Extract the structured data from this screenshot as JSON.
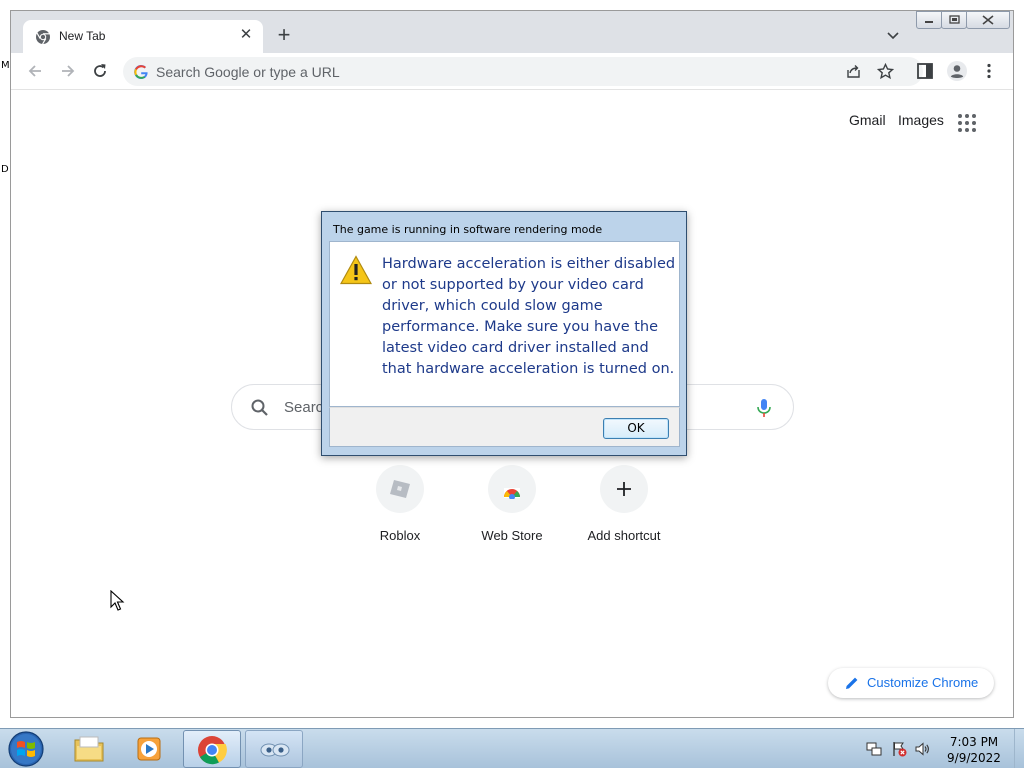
{
  "desktop": {
    "edge_letters": [
      "M",
      "D"
    ]
  },
  "browser": {
    "tab": {
      "title": "New Tab"
    },
    "omnibox": {
      "placeholder": "Search Google or type a URL"
    },
    "ntp": {
      "links": [
        "Gmail",
        "Images"
      ],
      "search_placeholder": "Search Google or type a URL",
      "search_visible_text": "Searc",
      "shortcuts": [
        {
          "label": "Roblox",
          "icon": "roblox-icon"
        },
        {
          "label": "Web Store",
          "icon": "web-store-icon"
        },
        {
          "label": "Add shortcut",
          "icon": "plus-icon"
        }
      ],
      "customize_label": "Customize Chrome"
    }
  },
  "dialog": {
    "title": "The game is running in software rendering mode",
    "message": "Hardware acceleration is either disabled or not supported by your video card driver, which could slow game performance. Make sure you have the latest video card driver installed and that hardware acceleration is turned on.",
    "ok_label": "OK"
  },
  "taskbar": {
    "apps": [
      "start-orb",
      "file-explorer",
      "media-player",
      "chrome",
      "game-app"
    ],
    "clock": {
      "time": "7:03 PM",
      "date": "9/9/2022"
    }
  },
  "colors": {
    "tabstrip": "#dee1e6",
    "link_blue": "#1a73e8",
    "dialog_text": "#1e3a8a",
    "dialog_frame": "#bcd3ea"
  }
}
